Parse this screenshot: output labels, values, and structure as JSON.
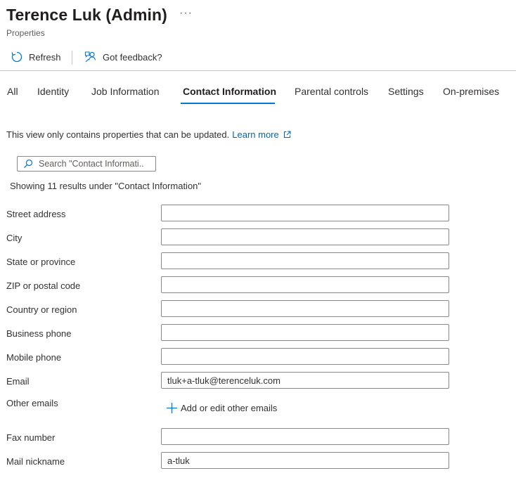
{
  "header": {
    "title": "Terence Luk (Admin)",
    "more": "···",
    "subtitle": "Properties"
  },
  "toolbar": {
    "refresh_label": "Refresh",
    "feedback_label": "Got feedback?"
  },
  "tabs": [
    {
      "label": "All"
    },
    {
      "label": "Identity"
    },
    {
      "label": "Job Information"
    },
    {
      "label": "Contact Information",
      "active": true
    },
    {
      "label": "Parental controls"
    },
    {
      "label": "Settings"
    },
    {
      "label": "On-premises"
    }
  ],
  "info": {
    "text": "This view only contains properties that can be updated.",
    "learn_more": "Learn more"
  },
  "search": {
    "placeholder": "Search \"Contact Informati..."
  },
  "showing": "Showing 11 results under \"Contact Information\"",
  "fields": {
    "street_address": {
      "label": "Street address",
      "value": ""
    },
    "city": {
      "label": "City",
      "value": ""
    },
    "state": {
      "label": "State or province",
      "value": ""
    },
    "zip": {
      "label": "ZIP or postal code",
      "value": ""
    },
    "country": {
      "label": "Country or region",
      "value": ""
    },
    "business_phone": {
      "label": "Business phone",
      "value": ""
    },
    "mobile_phone": {
      "label": "Mobile phone",
      "value": ""
    },
    "email": {
      "label": "Email",
      "value": "tluk+a-tluk@terenceluk.com"
    },
    "other_emails": {
      "label": "Other emails",
      "action": "Add or edit other emails"
    },
    "fax": {
      "label": "Fax number",
      "value": ""
    },
    "mail_nickname": {
      "label": "Mail nickname",
      "value": "a-tluk"
    }
  },
  "colors": {
    "accent": "#0078d4",
    "link": "#0067b8",
    "border": "#8a8886"
  }
}
